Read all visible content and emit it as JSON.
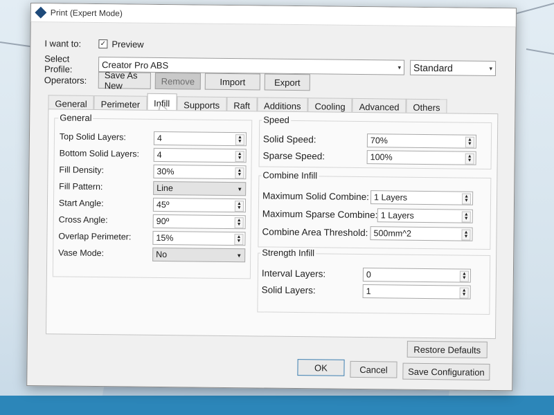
{
  "window": {
    "title": "Print (Expert Mode)"
  },
  "top": {
    "want_label": "I want to:",
    "preview_label": "Preview",
    "preview_checked": true,
    "profile_label": "Select Profile:",
    "profile_value": "Creator Pro ABS",
    "quality_value": "Standard",
    "operators_label": "Operators:",
    "buttons": [
      "Save As New",
      "Remove",
      "Import",
      "Export"
    ]
  },
  "tabs": [
    "General",
    "Perimeter",
    "Infill",
    "Supports",
    "Raft",
    "Additions",
    "Cooling",
    "Advanced",
    "Others"
  ],
  "active_tab": "Infill",
  "general": {
    "title": "General",
    "fields": [
      {
        "label": "Top Solid Layers:",
        "value": "4",
        "type": "spin"
      },
      {
        "label": "Bottom Solid Layers:",
        "value": "4",
        "type": "spin"
      },
      {
        "label": "Fill Density:",
        "value": "30%",
        "type": "spin"
      },
      {
        "label": "Fill Pattern:",
        "value": "Line",
        "type": "drop"
      },
      {
        "label": "Start Angle:",
        "value": "45º",
        "type": "spin"
      },
      {
        "label": "Cross Angle:",
        "value": "90º",
        "type": "spin"
      },
      {
        "label": "Overlap Perimeter:",
        "value": "15%",
        "type": "spin"
      },
      {
        "label": "Vase Mode:",
        "value": "No",
        "type": "drop"
      }
    ]
  },
  "speed": {
    "title": "Speed",
    "fields": [
      {
        "label": "Solid Speed:",
        "value": "70%"
      },
      {
        "label": "Sparse Speed:",
        "value": "100%"
      }
    ]
  },
  "combine": {
    "title": "Combine Infill",
    "fields": [
      {
        "label": "Maximum Solid Combine:",
        "value": "1 Layers"
      },
      {
        "label": "Maximum Sparse Combine:",
        "value": "1 Layers"
      },
      {
        "label": "Combine Area Threshold:",
        "value": "500mm^2"
      }
    ]
  },
  "strength": {
    "title": "Strength Infill",
    "fields": [
      {
        "label": "Interval Layers:",
        "value": "0"
      },
      {
        "label": "Solid Layers:",
        "value": "1"
      }
    ]
  },
  "footer": {
    "restore": "Restore Defaults",
    "ok": "OK",
    "cancel": "Cancel",
    "save": "Save Configuration"
  }
}
